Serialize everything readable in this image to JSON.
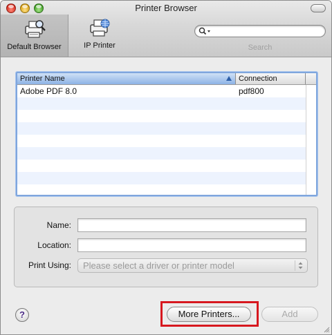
{
  "window": {
    "title": "Printer Browser"
  },
  "toolbar": {
    "default_browser_label": "Default Browser",
    "ip_printer_label": "IP Printer",
    "search_caption": "Search"
  },
  "printer_list": {
    "columns": [
      "Printer Name",
      "Connection"
    ],
    "rows": [
      {
        "name": "Adobe PDF 8.0",
        "connection": "pdf800"
      },
      {
        "name": "",
        "connection": ""
      },
      {
        "name": "",
        "connection": ""
      },
      {
        "name": "",
        "connection": ""
      },
      {
        "name": "",
        "connection": ""
      },
      {
        "name": "",
        "connection": ""
      },
      {
        "name": "",
        "connection": ""
      },
      {
        "name": "",
        "connection": ""
      },
      {
        "name": "",
        "connection": ""
      }
    ]
  },
  "details": {
    "name_label": "Name:",
    "location_label": "Location:",
    "print_using_label": "Print Using:",
    "print_using_value": "Please select a driver or printer model"
  },
  "buttons": {
    "help": "?",
    "more_printers": "More Printers...",
    "add": "Add"
  },
  "colors": {
    "highlight": "#d7181f",
    "header_blue": "#8db3e6"
  }
}
